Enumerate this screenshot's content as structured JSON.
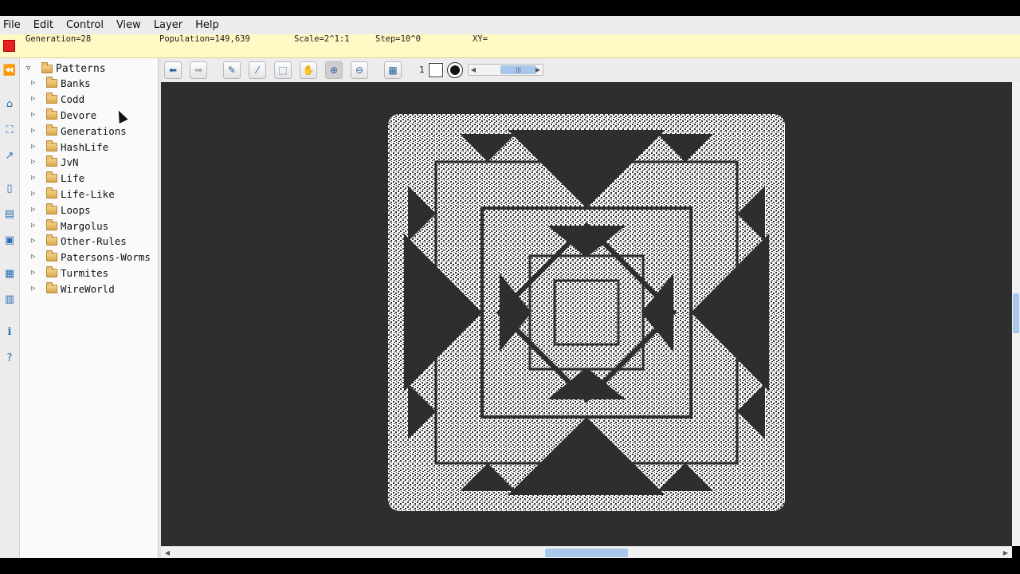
{
  "menubar": {
    "items": [
      "File",
      "Edit",
      "Control",
      "View",
      "Layer",
      "Help"
    ]
  },
  "status": {
    "generation": "Generation=28",
    "population": "Population=149,639",
    "scale": "Scale=2^1:1",
    "step": "Step=10^0",
    "xy": "XY="
  },
  "tree": {
    "root": "Patterns",
    "folders": [
      "Banks",
      "Codd",
      "Devore",
      "Generations",
      "HashLife",
      "JvN",
      "Life",
      "Life-Like",
      "Loops",
      "Margolus",
      "Other-Rules",
      "Patersons-Worms",
      "Turmites",
      "WireWorld"
    ]
  },
  "toolbar": {
    "layer_number": "1"
  },
  "colors": {
    "status_bg": "#fff9c4",
    "viewport_bg": "#2e2e2e",
    "cells": "#ffffff",
    "stop": "#e52222"
  },
  "icons": [
    "back-icon",
    "forward-icon",
    "pencil-icon",
    "picker-icon",
    "select-icon",
    "hand-icon",
    "zoom-in-icon",
    "zoom-out-icon",
    "grid-icon"
  ]
}
